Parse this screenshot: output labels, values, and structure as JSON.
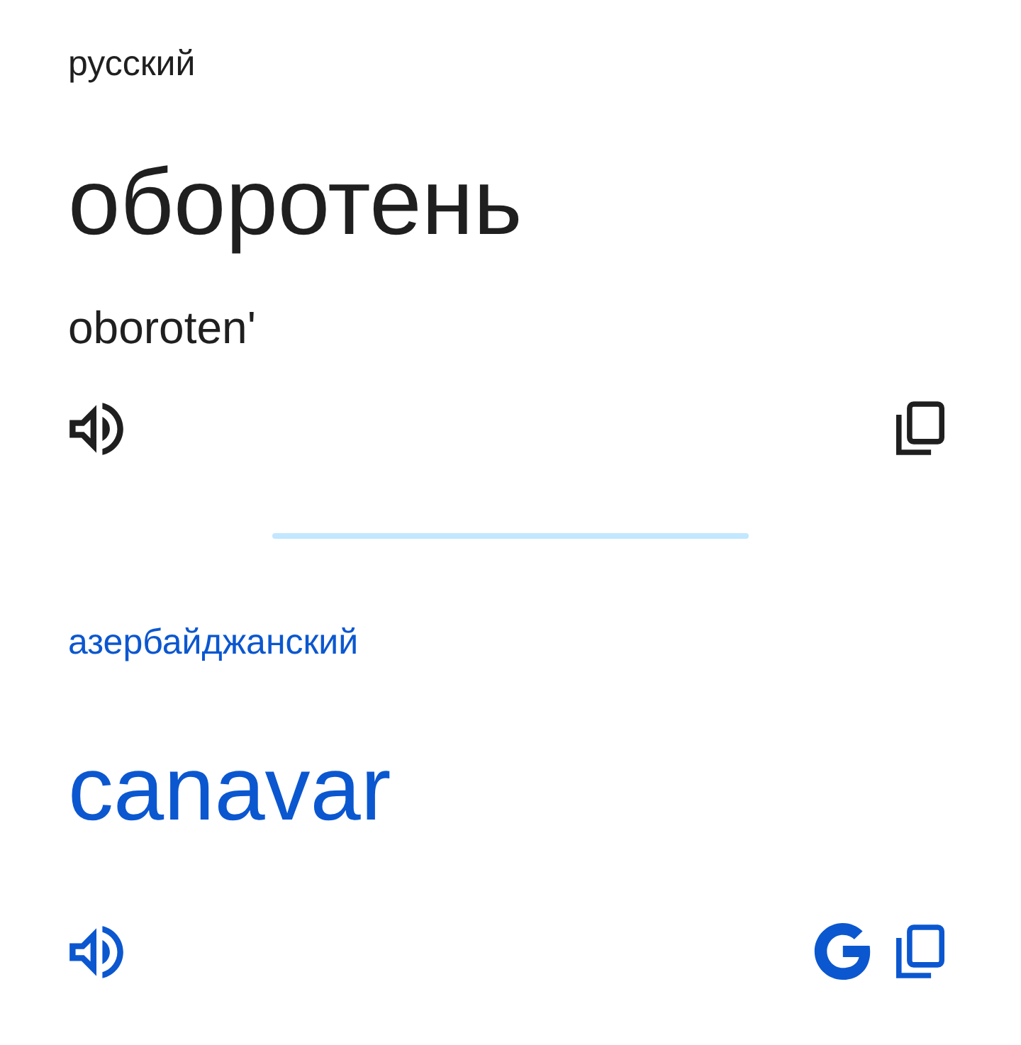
{
  "source": {
    "language": "русский",
    "text": "оборотень",
    "transliteration": "oboroten'",
    "actions": [
      {
        "kind": "listen"
      },
      {
        "kind": "copy"
      }
    ]
  },
  "target": {
    "language": "азербайджанский",
    "text": "canavar",
    "actions": [
      {
        "kind": "listen"
      },
      {
        "kind": "google"
      },
      {
        "kind": "copy"
      }
    ]
  }
}
